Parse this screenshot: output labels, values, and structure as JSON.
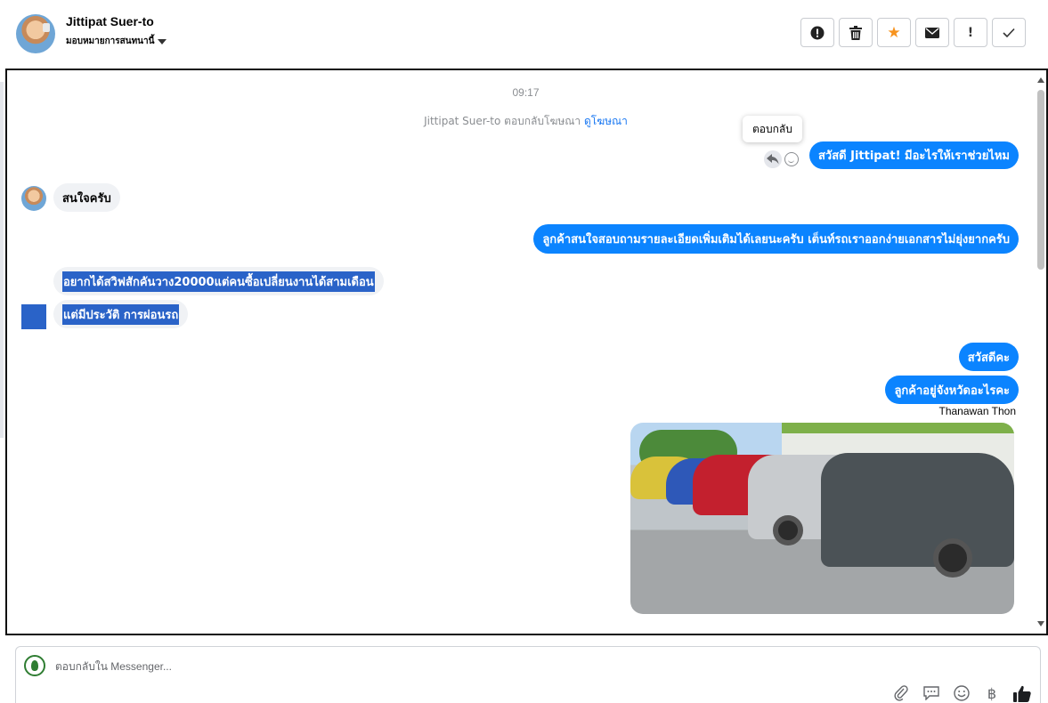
{
  "header": {
    "contact_name": "Jittipat Suer-to",
    "assign_label": "มอบหมายการสนทนานี้"
  },
  "toolbar": {
    "buttons": [
      {
        "name": "spam-button",
        "icon": "alert-circle-icon",
        "glyph": "!"
      },
      {
        "name": "delete-button",
        "icon": "trash-icon",
        "glyph": ""
      },
      {
        "name": "star-button",
        "icon": "star-icon",
        "glyph": "★"
      },
      {
        "name": "mark-unread-button",
        "icon": "envelope-icon",
        "glyph": "✉"
      },
      {
        "name": "follow-up-button",
        "icon": "exclamation-icon",
        "glyph": "!"
      },
      {
        "name": "done-button",
        "icon": "check-icon",
        "glyph": "✓"
      }
    ],
    "star_color": "#f7931e"
  },
  "chat": {
    "timestamp": "09:17",
    "ad_reply_prefix": "Jittipat Suer-to ตอบกลับโฆษณา",
    "ad_link": "ดูโฆษณา",
    "tooltip": "ตอบกลับ",
    "messages": [
      {
        "dir": "out",
        "text": "สวัสดี Jittipat! มีอะไรให้เราช่วยไหม"
      },
      {
        "dir": "in",
        "text": "สนใจครับ"
      },
      {
        "dir": "out",
        "text": "ลูกค้าสนใจสอบถามรายละเอียดเพิ่มเติมได้เลยนะครับ เต็นท์รถเราออกง่ายเอกสารไม่ยุ่งยากครับ"
      },
      {
        "dir": "in",
        "text": "อยากได้สวิฟสักคันวาง20000แต่คนซื้อเปลี่ยนงานได้สามเดือน"
      },
      {
        "dir": "in",
        "text": "แต่มีประวัติ การผ่อนรถ"
      },
      {
        "dir": "out",
        "text": "สวัสดีคะ"
      },
      {
        "dir": "out",
        "text": "ลูกค้าอยู่จังหวัดอะไรคะ"
      }
    ],
    "sender_label": "Thanawan Thon",
    "outgoing_color": "#0b84ff",
    "incoming_color": "#f0f2f5",
    "highlight_color": "#2a63c8"
  },
  "composer": {
    "placeholder": "ตอบกลับใน Messenger...",
    "icons": [
      "paperclip-icon",
      "speech-bubble-icon",
      "emoji-icon",
      "baht-icon",
      "thumbs-up-icon"
    ],
    "baht_glyph": "฿"
  }
}
